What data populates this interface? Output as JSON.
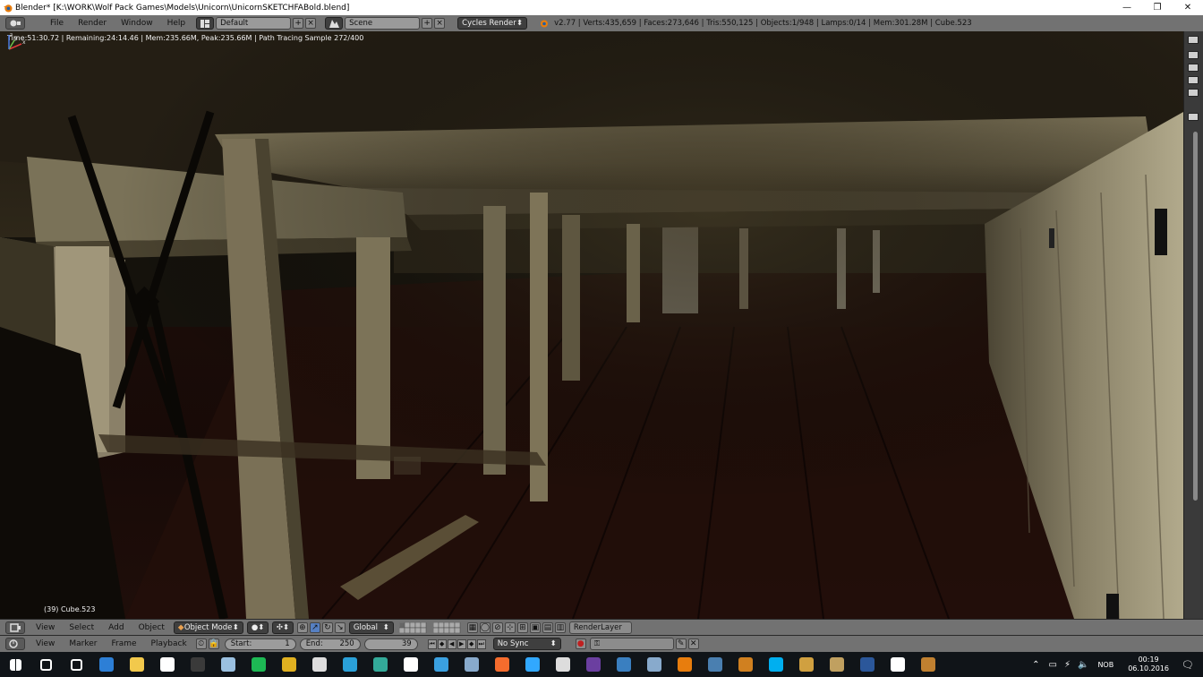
{
  "window": {
    "title": "Blender* [K:\\WORK\\Wolf Pack Games\\Models\\Unicorn\\UnicornSKETCHFABold.blend]",
    "controls": [
      "—",
      "❐",
      "✕"
    ]
  },
  "info_header": {
    "menus": [
      "File",
      "Render",
      "Window",
      "Help"
    ],
    "screen_layout": "Default",
    "scene": "Scene",
    "render_engine": "Cycles Render",
    "stats": "v2.77 | Verts:435,659 | Faces:273,646 | Tris:550,125 | Objects:1/948 | Lamps:0/14 | Mem:301.28M | Cube.523"
  },
  "viewport": {
    "render_status": "Time:51:30.72 | Remaining:24:14.46 | Mem:235.66M, Peak:235.66M | Path Tracing Sample 272/400",
    "object_label": "(39) Cube.523",
    "axes": {
      "x": "x",
      "y": "y",
      "z": "z",
      "x_color": "#e03c3c",
      "y_color": "#6cc04a",
      "z_color": "#4a78e0"
    }
  },
  "view3d_header": {
    "menus": [
      "View",
      "Select",
      "Add",
      "Object"
    ],
    "mode": "Object Mode",
    "orientation": "Global",
    "render_layer": "RenderLayer"
  },
  "timeline": {
    "menus": [
      "View",
      "Marker",
      "Frame",
      "Playback"
    ],
    "start_label": "Start:",
    "start_value": "1",
    "end_label": "End:",
    "end_value": "250",
    "current_frame": "39",
    "sync": "No Sync"
  },
  "taskbar": {
    "language": "NOB",
    "time": "00:19",
    "date": "06.10.2016",
    "apps": [
      {
        "name": "windows-start-icon",
        "color": "#ffffff"
      },
      {
        "name": "search-icon",
        "color": "#ffffff"
      },
      {
        "name": "task-view-icon",
        "color": "#ffffff"
      },
      {
        "name": "edge-icon",
        "color": "#2d7fd6"
      },
      {
        "name": "file-explorer-icon",
        "color": "#f2c94c"
      },
      {
        "name": "store-icon",
        "color": "#ffffff"
      },
      {
        "name": "app-icon-1",
        "color": "#3a3a3a"
      },
      {
        "name": "app-icon-2",
        "color": "#9ac0e0"
      },
      {
        "name": "spotify-icon",
        "color": "#1db954"
      },
      {
        "name": "chrome-icon",
        "color": "#e0b020"
      },
      {
        "name": "7zip-icon",
        "color": "#dddddd"
      },
      {
        "name": "app-icon-3",
        "color": "#2aa0d8"
      },
      {
        "name": "app-icon-4",
        "color": "#3a9"
      },
      {
        "name": "app-icon-5",
        "color": "#ffffff"
      },
      {
        "name": "lightroom-icon",
        "color": "#3aa0e0"
      },
      {
        "name": "app-icon-6",
        "color": "#8ac"
      },
      {
        "name": "origin-icon",
        "color": "#f56c2d"
      },
      {
        "name": "photoshop-icon",
        "color": "#31a8ff"
      },
      {
        "name": "app-icon-7",
        "color": "#dddddd"
      },
      {
        "name": "app-icon-8",
        "color": "#6b3fa0"
      },
      {
        "name": "wordpress-icon",
        "color": "#3a7fc0"
      },
      {
        "name": "app-icon-9",
        "color": "#88aacc"
      },
      {
        "name": "blender-icon",
        "color": "#e87d0d"
      },
      {
        "name": "steam-icon",
        "color": "#4a7fb0"
      },
      {
        "name": "app-icon-10",
        "color": "#d08020"
      },
      {
        "name": "skype-icon",
        "color": "#00aff0"
      },
      {
        "name": "app-icon-11",
        "color": "#d0a040"
      },
      {
        "name": "app-icon-12",
        "color": "#c0a060"
      },
      {
        "name": "word-icon",
        "color": "#2b579a"
      },
      {
        "name": "photos-icon",
        "color": "#ffffff"
      },
      {
        "name": "app-icon-13",
        "color": "#c08030"
      }
    ]
  }
}
